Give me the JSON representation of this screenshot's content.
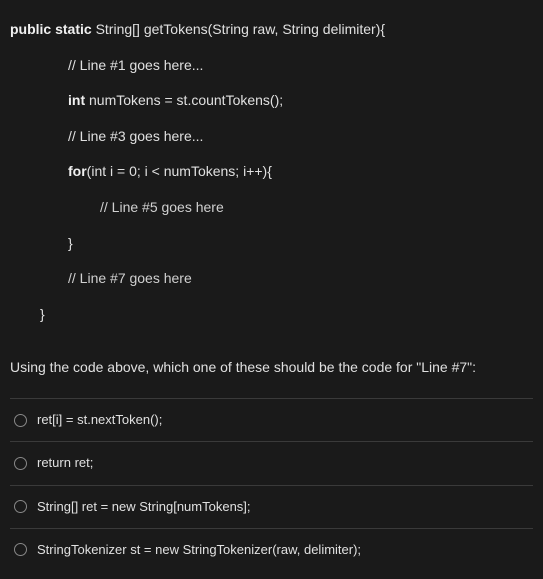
{
  "code": {
    "l1_a": "public static ",
    "l1_b": "String[] getTokens(String raw, String delimiter){",
    "l2": "// Line #1 goes here...",
    "l3_a": "int ",
    "l3_b": "numTokens = st.countTokens();",
    "l4": "// Line #3 goes here...",
    "l5_a": "for",
    "l5_b": "(int i = 0; i < numTokens; i++){",
    "l6": "// Line #5 goes here",
    "l7": "}",
    "l8": "// Line #7 goes here",
    "l9": "}"
  },
  "question": "Using the code above, which one of these should be the code for \"Line #7\":",
  "options": [
    {
      "label": "ret[i] = st.nextToken();"
    },
    {
      "label": "return ret;"
    },
    {
      "label": "String[] ret = new String[numTokens];"
    },
    {
      "label": "StringTokenizer st = new StringTokenizer(raw, delimiter);"
    }
  ]
}
